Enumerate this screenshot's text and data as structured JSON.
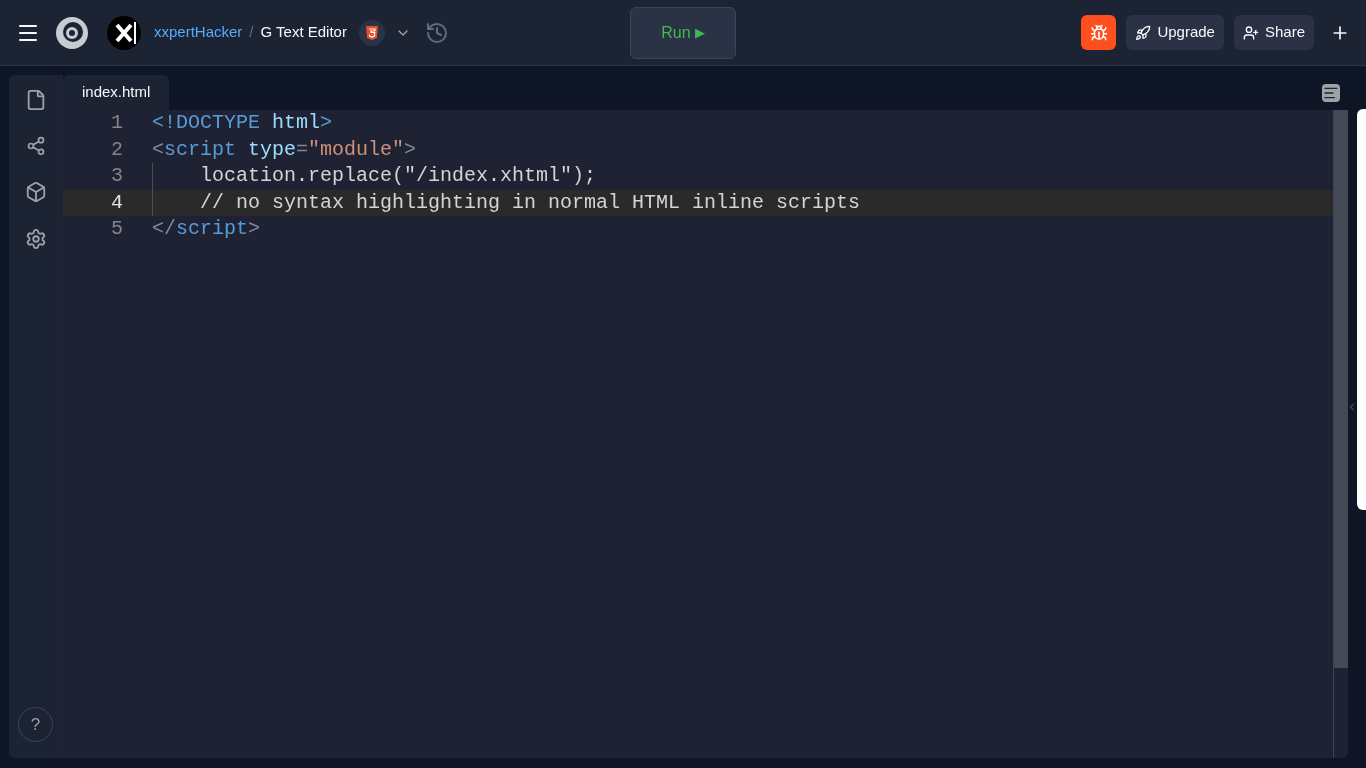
{
  "header": {
    "owner": "xxpertHacker",
    "separator": "/",
    "project": "G Text Editor",
    "run_button": {
      "label": "Run",
      "icon": "▶"
    },
    "upgrade_button": "Upgrade",
    "share_button": "Share"
  },
  "tabs": [
    {
      "label": "index.html",
      "selected": true
    }
  ],
  "editor": {
    "lines": [
      {
        "number": "1",
        "active": false,
        "indented": false,
        "tokens": [
          {
            "kind": "tag",
            "text": "<!DOCTYPE"
          },
          {
            "kind": "attr",
            "text": " html"
          },
          {
            "kind": "tag",
            "text": ">"
          }
        ]
      },
      {
        "number": "2",
        "active": false,
        "indented": false,
        "tokens": [
          {
            "kind": "punct",
            "text": "<"
          },
          {
            "kind": "tag",
            "text": "script"
          },
          {
            "kind": "attr",
            "text": " type"
          },
          {
            "kind": "punct",
            "text": "="
          },
          {
            "kind": "string",
            "text": "\"module\""
          },
          {
            "kind": "punct",
            "text": ">"
          }
        ]
      },
      {
        "number": "3",
        "active": false,
        "indented": true,
        "tokens": [
          {
            "kind": "plain",
            "text": "location.replace(\"/index.xhtml\");"
          }
        ]
      },
      {
        "number": "4",
        "active": true,
        "indented": true,
        "tokens": [
          {
            "kind": "plain",
            "text": "// no syntax highlighting in normal HTML inline scripts"
          }
        ]
      },
      {
        "number": "5",
        "active": false,
        "indented": false,
        "tokens": [
          {
            "kind": "punct",
            "text": "</"
          },
          {
            "kind": "tag",
            "text": "script"
          },
          {
            "kind": "punct",
            "text": ">"
          }
        ]
      }
    ]
  },
  "help_button": "?"
}
